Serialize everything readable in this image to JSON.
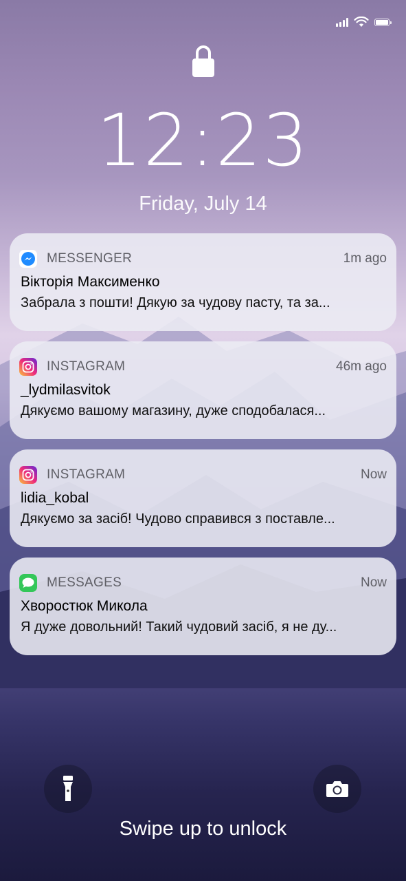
{
  "clock": {
    "time": "12:23",
    "date": "Friday, July 14"
  },
  "notifications": [
    {
      "app": "MESSENGER",
      "icon": "messenger-icon",
      "time_ago": "1m ago",
      "sender": "Вікторія Максименко",
      "message": "Забрала з пошти! Дякую за чудову пасту, та за..."
    },
    {
      "app": "INSTAGRAM",
      "icon": "instagram-icon",
      "time_ago": "46m ago",
      "sender": "_lydmilasvitok",
      "message": "Дякуємо вашому магазину, дуже сподобалася..."
    },
    {
      "app": "INSTAGRAM",
      "icon": "instagram-icon",
      "time_ago": "Now",
      "sender": "lidia_kobal",
      "message": "Дякуємо за засіб! Чудово справився з поставле..."
    },
    {
      "app": "MESSAGES",
      "icon": "messages-icon",
      "time_ago": "Now",
      "sender": "Хворостюк Микола",
      "message": "Я дуже довольний! Такий чудовий засіб, я не ду..."
    }
  ],
  "bottom": {
    "hint": "Swipe up to unlock",
    "left_icon": "flashlight-icon",
    "right_icon": "camera-icon"
  },
  "colors": {
    "messenger": "#1f8bff",
    "messages": "#34c759"
  }
}
